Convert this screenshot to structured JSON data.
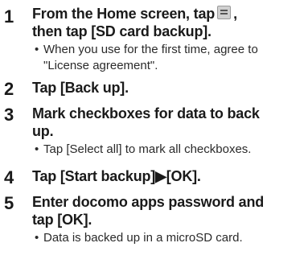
{
  "steps": [
    {
      "number": "1",
      "title_part1": "From the Home screen, tap",
      "title_part2": ",",
      "title_line2": "then tap [SD card backup].",
      "menu_icon": "menu-icon",
      "note_line1": "When you use for the first time, agree to",
      "note_line2": "\"License agreement\"."
    },
    {
      "number": "2",
      "title": "Tap [Back up]."
    },
    {
      "number": "3",
      "title_line1": "Mark checkboxes for data to back",
      "title_line2": "up.",
      "note": "Tap [Select all] to mark all checkboxes."
    },
    {
      "number": "4",
      "title": "Tap [Start backup]▶[OK]."
    },
    {
      "number": "5",
      "title_line1": "Enter docomo apps password and",
      "title_line2": "tap [OK].",
      "note": "Data is backed up in a microSD card."
    }
  ],
  "bullet": "•"
}
